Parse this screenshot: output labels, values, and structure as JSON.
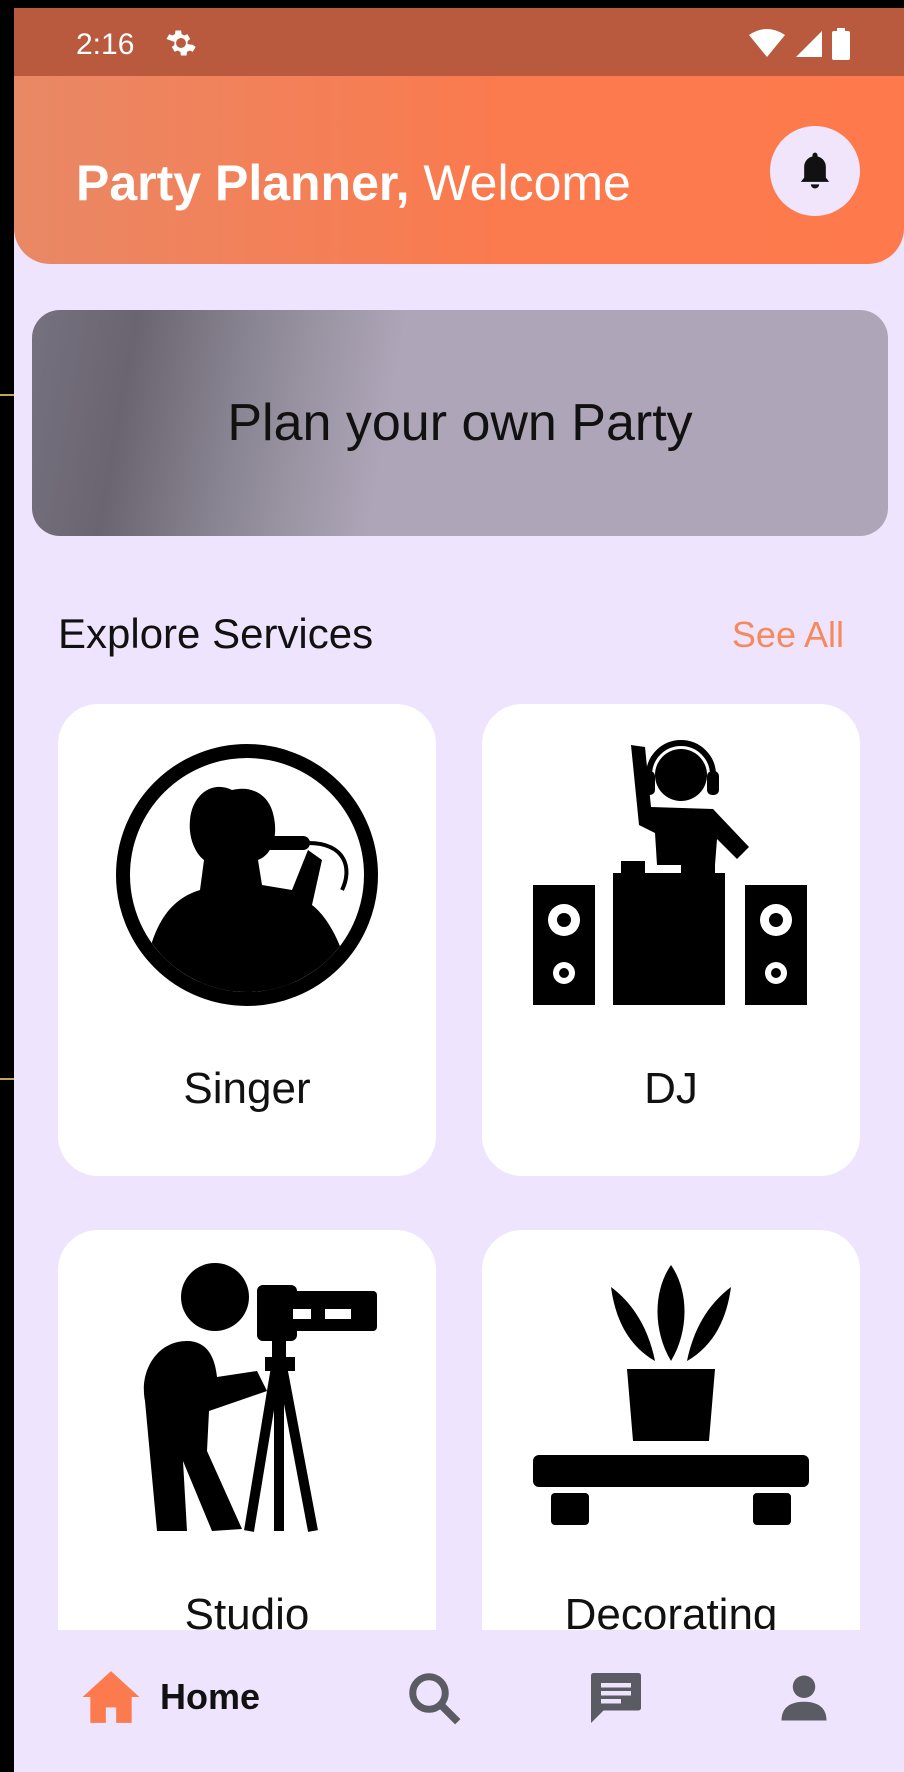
{
  "status_bar": {
    "time": "2:16",
    "icons": [
      "gear-icon",
      "wifi-icon",
      "signal-icon",
      "battery-icon"
    ]
  },
  "header": {
    "app_name": "Party Planner,",
    "greeting": " Welcome",
    "bell_icon": "bell-icon"
  },
  "banner": {
    "text": "Plan your own Party"
  },
  "services": {
    "title": "Explore Services",
    "see_all": "See All",
    "items": [
      {
        "label": "Singer",
        "icon": "singer-icon"
      },
      {
        "label": "DJ",
        "icon": "dj-icon"
      },
      {
        "label": "Studio",
        "icon": "camera-operator-icon"
      },
      {
        "label": "Decorating",
        "icon": "plant-table-icon"
      }
    ]
  },
  "bottom_nav": {
    "home_label": "Home",
    "items": [
      "home-icon",
      "search-icon",
      "chat-icon",
      "profile-icon"
    ]
  },
  "colors": {
    "accent": "#FB7A4E",
    "background": "#EFE4FD",
    "see_all": "#F58A5E"
  }
}
